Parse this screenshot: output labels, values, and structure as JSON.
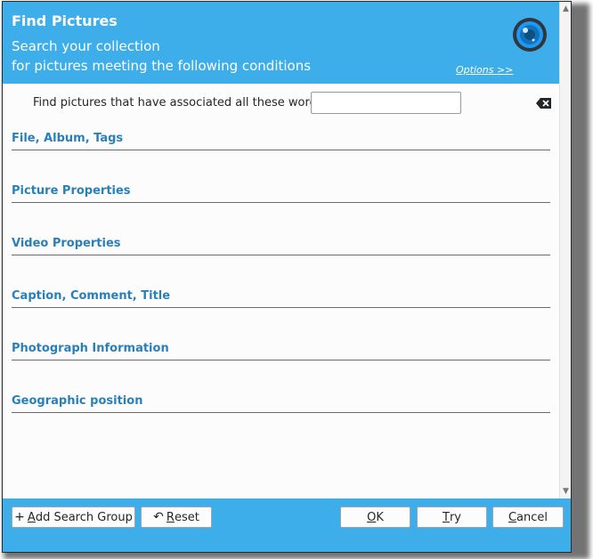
{
  "header": {
    "title": "Find Pictures",
    "subtitle_line1": "Search your collection",
    "subtitle_line2": "for pictures meeting the following conditions",
    "options_link": "Options >>"
  },
  "search": {
    "label": "Find pictures that have associated all these words:",
    "value": "",
    "placeholder": ""
  },
  "sections": [
    {
      "title": "File, Album, Tags"
    },
    {
      "title": "Picture Properties"
    },
    {
      "title": "Video Properties"
    },
    {
      "title": "Caption, Comment, Title"
    },
    {
      "title": "Photograph Information"
    },
    {
      "title": "Geographic position"
    }
  ],
  "footer": {
    "add_group": {
      "prefix": "",
      "mnemonic": "A",
      "rest": "dd Search Group"
    },
    "reset": {
      "mnemonic": "R",
      "rest": "eset"
    },
    "ok": {
      "mnemonic": "O",
      "rest": "K"
    },
    "try": {
      "mnemonic": "T",
      "rest": "ry"
    },
    "cancel": {
      "mnemonic": "C",
      "rest": "ancel"
    }
  },
  "colors": {
    "accent": "#3daee9",
    "section_title": "#2980b9",
    "background": "#fcfcfc"
  },
  "icons": {
    "logo": "camera-lens-icon",
    "clear": "clear-text-icon",
    "add": "plus-icon",
    "reset": "undo-icon"
  }
}
